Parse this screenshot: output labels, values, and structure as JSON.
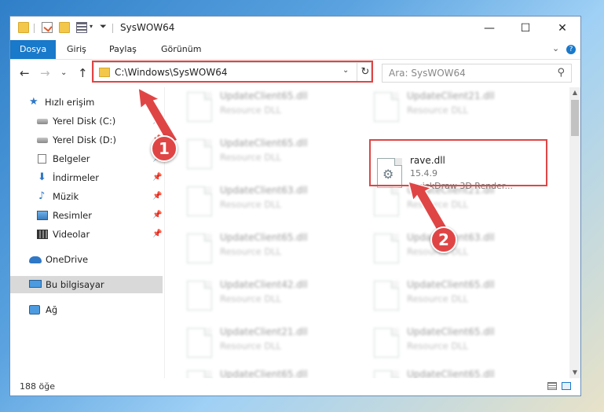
{
  "window": {
    "title": "SysWOW64",
    "controls": {
      "minimize": "—",
      "maximize": "☐",
      "close": "✕"
    }
  },
  "ribbon": {
    "tabs": [
      "Dosya",
      "Giriş",
      "Paylaş",
      "Görünüm"
    ],
    "active_tab": "Dosya",
    "expand_glyph": "⌄",
    "help_glyph": "?"
  },
  "navigation": {
    "back": "←",
    "forward": "→",
    "recent": "⌄",
    "up": "↑",
    "address": "C:\\Windows\\SysWOW64",
    "address_dropdown": "⌄",
    "refresh": "↻",
    "search_placeholder": "Ara: SysWOW64",
    "search_glyph": "⚲"
  },
  "sidebar": {
    "items": [
      {
        "label": "Hızlı erişim",
        "icon": "star-icon",
        "pinned": false
      },
      {
        "label": "Yerel Disk (C:)",
        "icon": "drive-icon",
        "pinned": true
      },
      {
        "label": "Yerel Disk (D:)",
        "icon": "drive-icon",
        "pinned": true
      },
      {
        "label": "Belgeler",
        "icon": "documents-icon",
        "pinned": true
      },
      {
        "label": "İndirmeler",
        "icon": "downloads-icon",
        "pinned": true
      },
      {
        "label": "Müzik",
        "icon": "music-icon",
        "pinned": true
      },
      {
        "label": "Resimler",
        "icon": "pictures-icon",
        "pinned": true
      },
      {
        "label": "Videolar",
        "icon": "videos-icon",
        "pinned": true
      },
      {
        "label": "OneDrive",
        "icon": "cloud-icon",
        "pinned": false
      },
      {
        "label": "Bu bilgisayar",
        "icon": "computer-icon",
        "pinned": false,
        "selected": true
      },
      {
        "label": "Ağ",
        "icon": "network-icon",
        "pinned": false
      }
    ],
    "pin_glyph": "📌"
  },
  "files": {
    "left_column": [
      {
        "name": "UpdateClient65.dll",
        "type": "Resource DLL"
      },
      {
        "name": "UpdateClient65.dll",
        "type": "Resource DLL"
      },
      {
        "name": "UpdateClient63.dll",
        "type": "Resource DLL"
      },
      {
        "name": "UpdateClient65.dll",
        "type": "Resource DLL"
      },
      {
        "name": "UpdateClient42.dll",
        "type": "Resource DLL"
      },
      {
        "name": "UpdateClient21.dll",
        "type": "Resource DLL"
      },
      {
        "name": "UpdateClient65.dll",
        "type": "Resource DLL"
      }
    ],
    "right_column": [
      {
        "name": "UpdateClient21.dll",
        "type": "Resource DLL"
      },
      {
        "name": "UpdateClient21.dll",
        "type": "Resource DLL"
      },
      {
        "name": "UpdateClient63.dll",
        "type": "Resource DLL"
      },
      {
        "name": "UpdateClient65.dll",
        "type": "Resource DLL"
      },
      {
        "name": "UpdateClient65.dll",
        "type": "Resource DLL"
      },
      {
        "name": "UpdateClient65.dll",
        "type": "Resource DLL"
      }
    ],
    "highlighted": {
      "name": "rave.dll",
      "version": "15.4.9",
      "description": "QuickDraw 3D Render..."
    }
  },
  "status": {
    "item_count": "188 öğe"
  },
  "annotations": {
    "step1": "1",
    "step2": "2",
    "color": "#e04545"
  }
}
